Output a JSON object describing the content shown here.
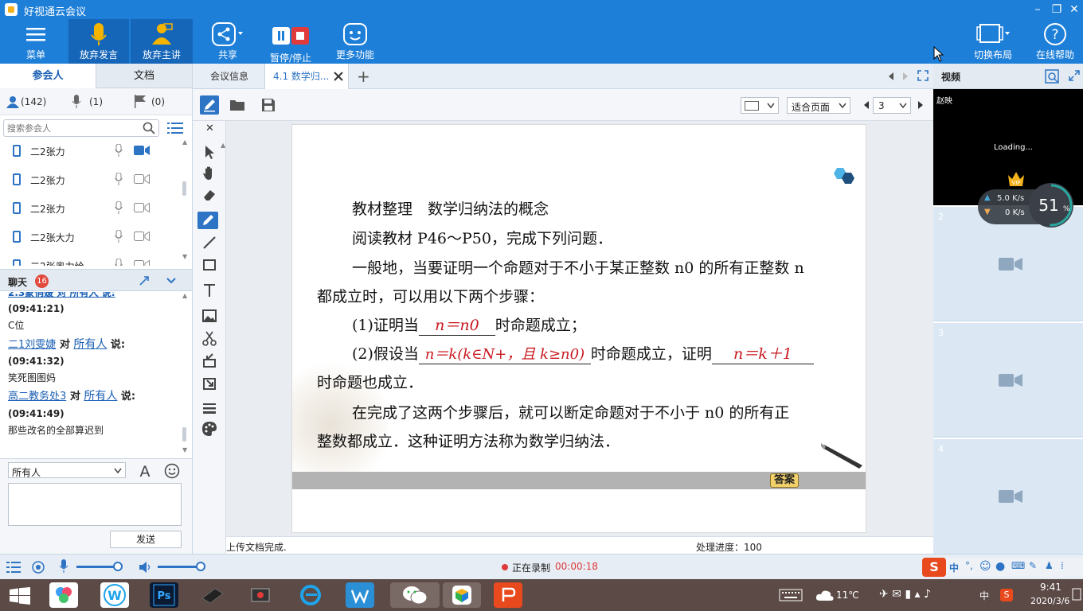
{
  "app": {
    "title": "好视通云会议"
  },
  "toolbar": {
    "menu": "菜单",
    "give_up_speak": "放弃发言",
    "give_up_host": "放弃主讲",
    "share": "共享",
    "pause_stop": "暂停/停止",
    "more": "更多功能",
    "switch_layout": "切换布局",
    "help": "在线帮助"
  },
  "left": {
    "tabs": [
      "参会人",
      "文档"
    ],
    "counts": {
      "participants": "(142)",
      "speaking": "(1)",
      "hands": "(0)"
    },
    "search_placeholder": "搜索参会人",
    "members": [
      {
        "name": "二2张力"
      },
      {
        "name": "二2张力"
      },
      {
        "name": "二2张力"
      },
      {
        "name": "二2张大力"
      },
      {
        "name": "二2张奥力给"
      }
    ],
    "chat": {
      "title": "聊天",
      "badge": "16",
      "partial_top": "2.3蒙俏媛 对 所有人 说:",
      "messages": [
        {
          "time": "(09:41:21)",
          "text": "C位"
        },
        {
          "sender": "二1刘雯婕",
          "to": "所有人",
          "say": "说:",
          "time": "(09:41:32)",
          "text": "笑死图图妈"
        },
        {
          "sender": "高二教务处3",
          "to": "所有人",
          "say": "说:",
          "time": "(09:41:49)",
          "text": "那些改名的全部算迟到"
        }
      ],
      "dui": "对",
      "recipient": "所有人",
      "send": "发送"
    }
  },
  "tabs": {
    "meeting_info": "会议信息",
    "active": "4.1 数学归...",
    "add": "+"
  },
  "doctools": {
    "fit": "适合页面",
    "page": "3"
  },
  "doc": {
    "l1": "教材整理　数学归纳法的概念",
    "l2": "阅读教材 P46～P50，完成下列问题．",
    "l3": "一般地，当要证明一个命题对于不小于某正整数 n0 的所有正整数 n",
    "l4": "都成立时，可以用以下两个步骤：",
    "l5a": "(1)证明当",
    "l5b": "n＝n0",
    "l5c": "时命题成立；",
    "l6a": "(2)假设当",
    "l6b": "n＝k(k∈N+，且 k≥n0)",
    "l6c": "时命题成立，证明",
    "l6d": "n＝k＋1",
    "l7": "时命题也成立．",
    "l8": "在完成了这两个步骤后，就可以断定命题对于不小于  n0  的所有正",
    "l9": "整数都成立．这种证明方法称为数学归纳法．",
    "answer": "答案"
  },
  "status": {
    "upload": "上传文档完成.",
    "progress": "处理进度：100"
  },
  "right": {
    "title": "视频",
    "user": "赵映",
    "loading": "Loading...",
    "up": "5.0",
    "down": "0",
    "speed_unit": "K/s",
    "cpu": "51",
    "cpu_unit": "%",
    "slots": [
      "2",
      "3",
      "4"
    ]
  },
  "bottom": {
    "recording": "正在录制",
    "timer": "00:00:18"
  },
  "taskbar": {
    "weather": "11℃",
    "ime": "中",
    "time": "9:41",
    "date": "2020/3/6"
  },
  "colors": {
    "brand": "#1e7fd8",
    "red": "#c8171e"
  }
}
